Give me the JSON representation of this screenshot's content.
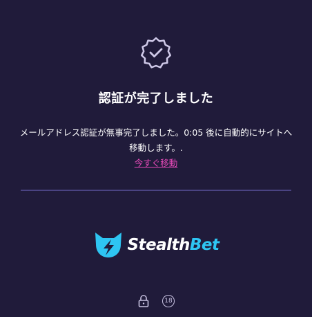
{
  "verification": {
    "title": "認証が完了しました",
    "message": "メールアドレス認証が無事完了しました。0:05 後に自動的にサイトへ移動します。.",
    "move_now_link": "今すぐ移動"
  },
  "brand": {
    "name_main": "Stealth",
    "name_accent": "Bet",
    "accent_color": "#2ec5f2"
  },
  "footer": {
    "age_label": "18"
  },
  "icons": {
    "badge": "verified-badge-icon",
    "logo": "cat-lightning-logo-icon",
    "lock": "lock-icon",
    "age": "age-18-icon"
  },
  "colors": {
    "background": "#201b3a",
    "link": "#e64ab8",
    "divider": "#4a4382"
  }
}
